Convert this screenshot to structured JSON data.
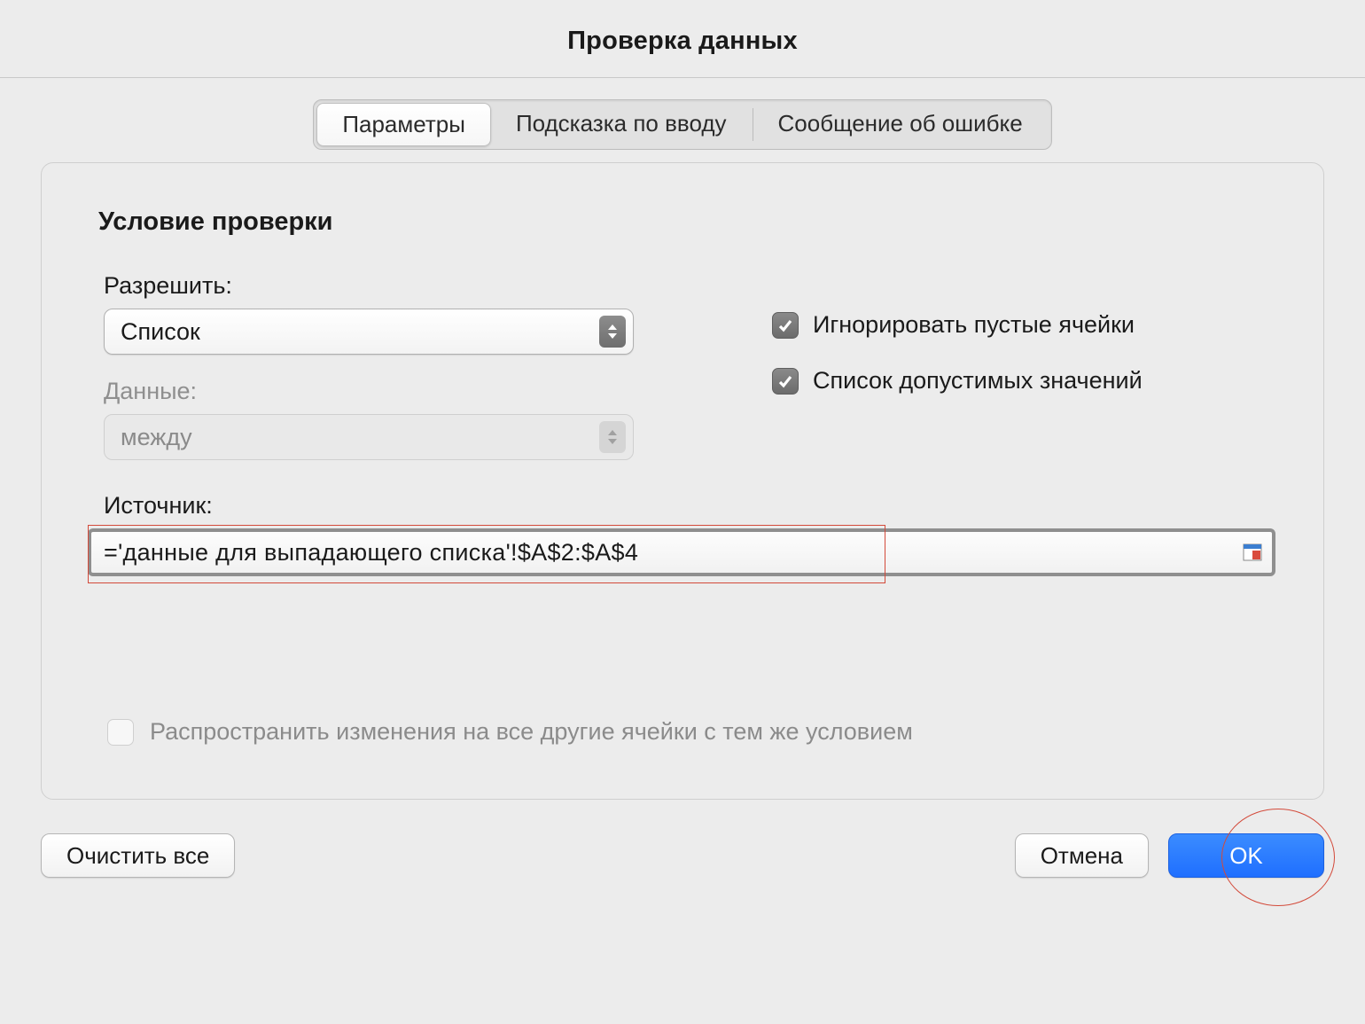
{
  "window": {
    "title": "Проверка данных"
  },
  "tabs": {
    "parameters": "Параметры",
    "input_hint": "Подсказка по вводу",
    "error_msg": "Сообщение об ошибке"
  },
  "section": {
    "title": "Условие проверки"
  },
  "allow": {
    "label": "Разрешить:",
    "value": "Список"
  },
  "data": {
    "label": "Данные:",
    "value": "между"
  },
  "checks": {
    "ignore_empty": "Игнорировать пустые ячейки",
    "in_cell_dropdown": "Список допустимых значений"
  },
  "source": {
    "label": "Источник:",
    "value": "='данные для выпадающего списка'!$A$2:$A$4"
  },
  "propagate": {
    "label": "Распространить изменения на все другие ячейки с тем же условием"
  },
  "buttons": {
    "clear_all": "Очистить все",
    "cancel": "Отмена",
    "ok": "OK"
  }
}
